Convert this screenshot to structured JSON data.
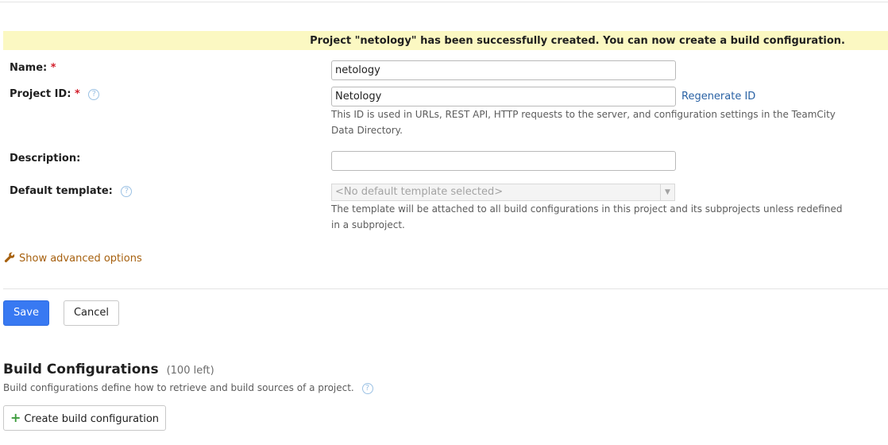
{
  "notice": {
    "text": "Project \"netology\" has been successfully created. You can now create a build configuration."
  },
  "form": {
    "name_label": "Name:",
    "name_required": "*",
    "name_value": "netology",
    "project_id_label": "Project ID:",
    "project_id_required": "*",
    "project_id_value": "Netology",
    "regenerate_link": "Regenerate ID",
    "project_id_note": "This ID is used in URLs, REST API, HTTP requests to the server, and configuration settings in the TeamCity Data Directory.",
    "description_label": "Description:",
    "description_value": "",
    "template_label": "Default template:",
    "template_value": "<No default template selected>",
    "template_note": "The template will be attached to all build configurations in this project and its subprojects unless redefined in a subproject.",
    "help_glyph": "?",
    "advanced_link": "Show advanced options"
  },
  "actions": {
    "save_label": "Save",
    "cancel_label": "Cancel"
  },
  "build_configs": {
    "title": "Build Configurations",
    "count": "(100 left)",
    "description": "Build configurations define how to retrieve and build sources of a project.",
    "create_label": "Create build configuration",
    "plus_glyph": "+"
  },
  "colors": {
    "notice_bg": "#fbf8c2",
    "primary": "#3879f2",
    "link": "#2a62a4",
    "advanced": "#a6600e",
    "required": "#d21d2a"
  },
  "icons": [
    "help-icon",
    "wrench-icon",
    "plus-icon",
    "chevron-down-icon"
  ]
}
